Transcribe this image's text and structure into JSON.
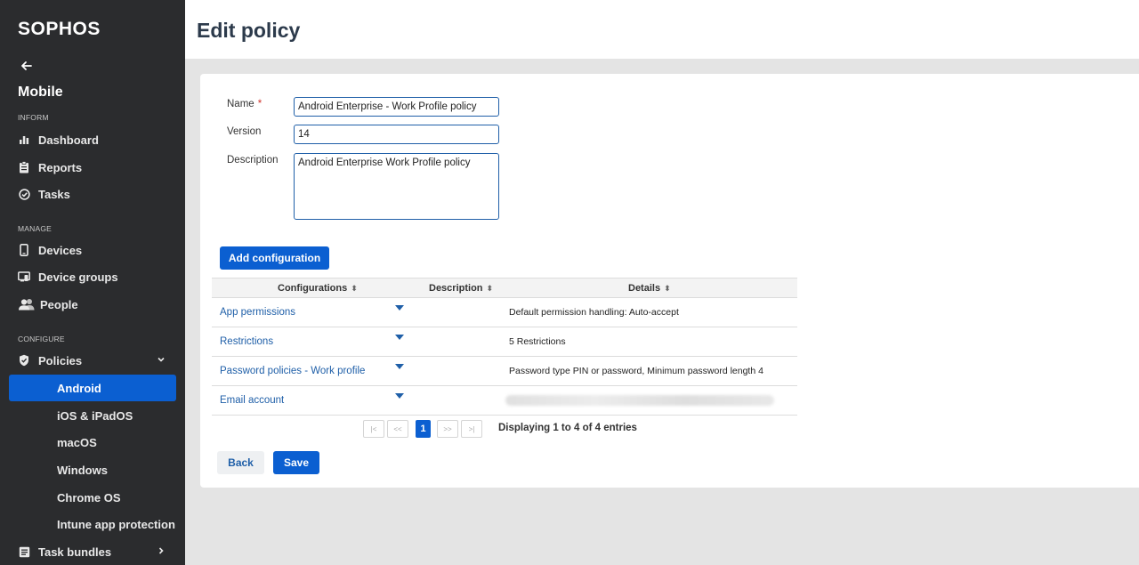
{
  "sidebar": {
    "logo": "SOPHOS",
    "section_title": "Mobile",
    "groups": {
      "inform": "INFORM",
      "manage": "MANAGE",
      "configure": "CONFIGURE"
    },
    "items": {
      "dashboard": "Dashboard",
      "reports": "Reports",
      "tasks": "Tasks",
      "devices": "Devices",
      "device_groups": "Device groups",
      "people": "People",
      "policies": "Policies",
      "task_bundles": "Task bundles"
    },
    "policy_subitems": [
      "Android",
      "iOS & iPadOS",
      "macOS",
      "Windows",
      "Chrome OS",
      "Intune app protection"
    ]
  },
  "header": {
    "title": "Edit policy"
  },
  "form": {
    "name_label": "Name",
    "required_mark": "*",
    "name_value": "Android Enterprise - Work Profile policy",
    "version_label": "Version",
    "version_value": "14",
    "description_label": "Description",
    "description_value": "Android Enterprise Work Profile policy"
  },
  "add_config_label": "Add configuration",
  "table": {
    "headers": [
      "Configurations",
      "Description",
      "Details"
    ],
    "rows": [
      {
        "configuration": "App permissions",
        "description": "",
        "details": "Default permission handling: Auto-accept"
      },
      {
        "configuration": "Restrictions",
        "description": "",
        "details": "5 Restrictions"
      },
      {
        "configuration": "Password policies - Work profile",
        "description": "",
        "details": "Password type PIN or password, Minimum password length 4"
      },
      {
        "configuration": "Email account",
        "description": "",
        "details": ""
      }
    ]
  },
  "pagination": {
    "first": "|<",
    "prev": "<<",
    "current": "1",
    "next": ">>",
    "last": ">|",
    "info": "Displaying 1 to 4 of 4 entries"
  },
  "actions": {
    "back": "Back",
    "save": "Save"
  },
  "colors": {
    "sidebar_bg": "#2b2c2e",
    "accent": "#0b5fd1",
    "link": "#1f5fa8"
  }
}
